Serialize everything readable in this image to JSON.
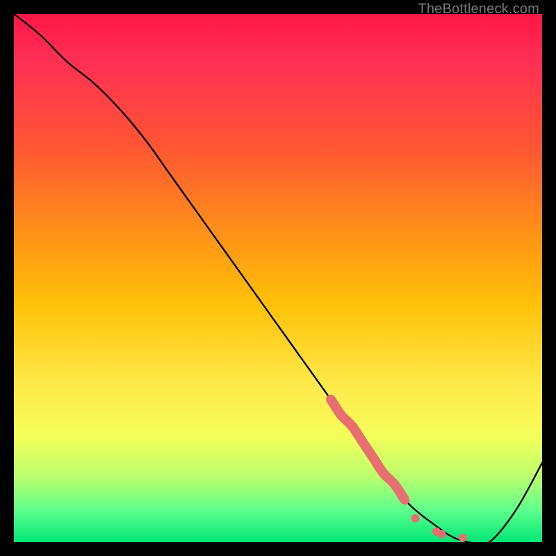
{
  "watermark": "TheBottleneck.com",
  "chart_data": {
    "type": "line",
    "title": "",
    "xlabel": "",
    "ylabel": "",
    "xlim": [
      0,
      100
    ],
    "ylim": [
      0,
      100
    ],
    "series": [
      {
        "name": "bottleneck-curve",
        "x": [
          0,
          5,
          10,
          15,
          20,
          25,
          30,
          35,
          40,
          45,
          50,
          55,
          60,
          65,
          70,
          75,
          80,
          83,
          86,
          90,
          95,
          100
        ],
        "y": [
          100,
          96,
          91,
          87,
          82,
          76,
          69,
          62,
          55,
          48,
          41,
          34,
          27,
          20,
          13,
          7,
          3,
          1,
          0,
          0,
          6,
          15
        ]
      }
    ],
    "highlight_segment": {
      "name": "thick-coral-segment",
      "color": "#e76f6f",
      "x": [
        60,
        62,
        64,
        66,
        68,
        70,
        72,
        74
      ],
      "y": [
        27,
        24,
        22,
        19,
        16,
        13,
        11,
        8
      ]
    },
    "highlight_points": {
      "name": "coral-dots",
      "color": "#e76f6f",
      "points": [
        {
          "x": 76,
          "y": 4.5
        },
        {
          "x": 80,
          "y": 2.0
        },
        {
          "x": 81,
          "y": 1.5
        },
        {
          "x": 85,
          "y": 0.8
        }
      ]
    }
  }
}
